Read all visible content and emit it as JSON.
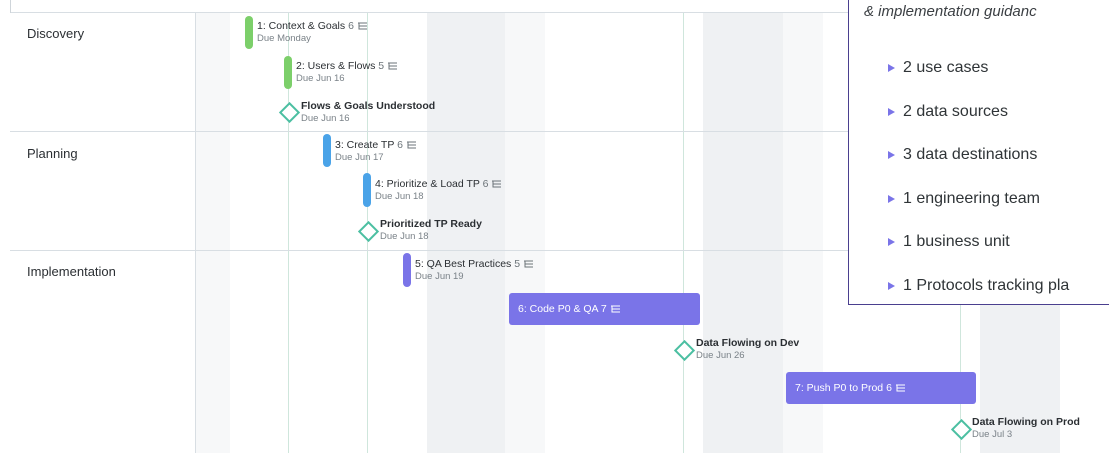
{
  "colors": {
    "discovery": "#7ccf6a",
    "planning": "#4aa3e8",
    "implementation": "#7a74e8",
    "milestone": "#4cbfa2",
    "panel_border": "#4a3f8f"
  },
  "phases": [
    {
      "label": "Discovery"
    },
    {
      "label": "Planning"
    },
    {
      "label": "Implementation"
    }
  ],
  "tasks": [
    {
      "title": "1: Context & Goals",
      "count": "6",
      "due": "Due Monday",
      "icon": "subtasks-icon"
    },
    {
      "title": "2: Users & Flows",
      "count": "5",
      "due": "Due Jun 16",
      "icon": "subtasks-icon"
    },
    {
      "title": "3: Create TP",
      "count": "6",
      "due": "Due Jun 17",
      "icon": "subtasks-icon"
    },
    {
      "title": "4: Prioritize & Load TP",
      "count": "6",
      "due": "Due Jun 18",
      "icon": "subtasks-icon"
    },
    {
      "title": "5: QA Best Practices",
      "count": "5",
      "due": "Due Jun 19",
      "icon": "subtasks-icon"
    },
    {
      "title": "6: Code P0 & QA",
      "count": "7",
      "icon": "subtasks-icon"
    },
    {
      "title": "7: Push P0 to Prod",
      "count": "6",
      "icon": "subtasks-icon"
    }
  ],
  "milestones": [
    {
      "title": "Flows & Goals Understood",
      "due": "Due Jun 16",
      "icon": "milestone-diamond-icon"
    },
    {
      "title": "Prioritized TP Ready",
      "due": "Due Jun 18",
      "icon": "milestone-diamond-icon"
    },
    {
      "title": "Data Flowing on Dev",
      "due": "Due Jun 26",
      "icon": "milestone-diamond-icon"
    },
    {
      "title": "Data Flowing on Prod",
      "due": "Due Jul 3",
      "icon": "milestone-diamond-icon"
    }
  ],
  "panel": {
    "subtitle": "& implementation guidanc",
    "items": [
      "2 use cases",
      "2 data sources",
      "3 data destinations",
      "1 engineering team",
      "1 business unit",
      "1 Protocols tracking pla"
    ]
  }
}
